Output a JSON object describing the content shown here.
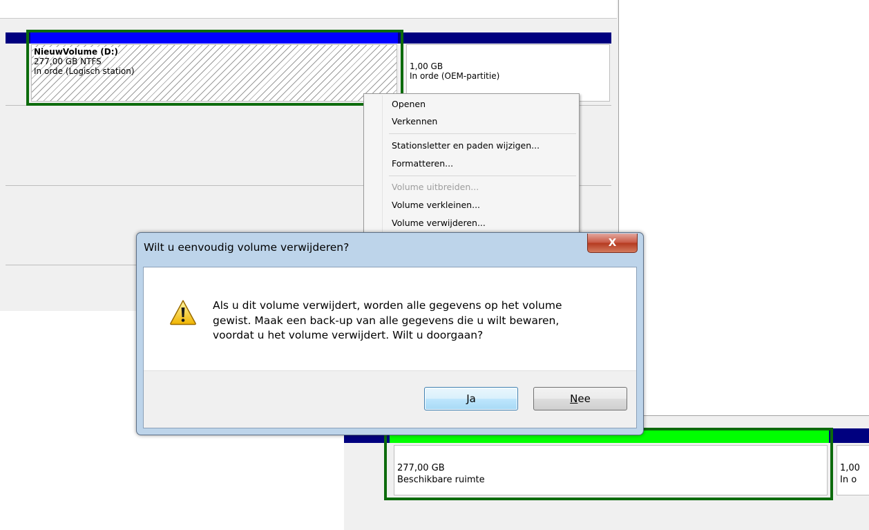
{
  "top_panel": {
    "volume_d": {
      "name": "NieuwVolume  (D:)",
      "size": "277,00 GB NTFS",
      "status": "In orde (Logisch station)"
    },
    "oem_partition": {
      "size": "1,00 GB",
      "status": "In orde (OEM-partitie)"
    }
  },
  "context_menu": {
    "items": [
      {
        "label": "Openen",
        "enabled": true
      },
      {
        "label": "Verkennen",
        "enabled": true
      },
      {
        "label": "Stationsletter en paden wijzigen...",
        "enabled": true
      },
      {
        "label": "Formatteren...",
        "enabled": true
      },
      {
        "label": "Volume uitbreiden...",
        "enabled": false
      },
      {
        "label": "Volume verkleinen...",
        "enabled": true
      },
      {
        "label": "Volume verwijderen...",
        "enabled": true
      }
    ]
  },
  "dialog": {
    "title": "Wilt u eenvoudig volume verwijderen?",
    "close_glyph": "X",
    "message_lines": [
      "Als u dit volume verwijdert, worden alle gegevens op het volume",
      "gewist. Maak een back-up van alle gegevens die u wilt bewaren,",
      "voordat u het volume verwijdert. Wilt u doorgaan?"
    ],
    "yes_label": "Ja",
    "no_label_underlined": "N",
    "no_label_rest": "ee",
    "icon": "warning-icon"
  },
  "bottom_panel": {
    "unallocated": {
      "size": "277,00 GB",
      "status": "Beschikbare ruimte"
    },
    "partial_size": "1,00",
    "partial_status": "In o"
  },
  "colors": {
    "primary_partition_header": "#0000ff",
    "logical_header": "#00007f",
    "selection_frame": "#0c6b0c",
    "unallocated_header": "#00ff00"
  }
}
